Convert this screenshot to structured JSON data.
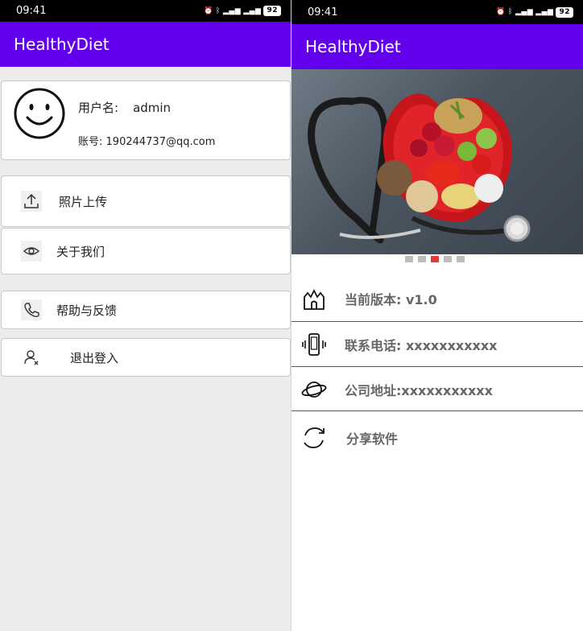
{
  "status_bar": {
    "time": "09:41",
    "battery": "92"
  },
  "app": {
    "title": "HealthyDiet"
  },
  "profile": {
    "username_label": "用户名:",
    "username": "admin",
    "account_label": "账号:",
    "account": "190244737@qq.com",
    "avatar_icon": "smiley-face-icon"
  },
  "menu": {
    "items": [
      {
        "label": "照片上传",
        "icon": "upload-icon"
      },
      {
        "label": "关于我们",
        "icon": "eye-icon"
      },
      {
        "label": "帮助与反馈",
        "icon": "phone-icon"
      },
      {
        "label": "退出登入",
        "icon": "user-logout-icon"
      }
    ]
  },
  "carousel": {
    "slides": 5,
    "active_index": 2,
    "active_color": "#e53935"
  },
  "info": {
    "items": [
      {
        "label": "当前版本: v1.0",
        "icon": "castle-icon"
      },
      {
        "label": "联系电话: xxxxxxxxxxx",
        "icon": "mobile-vibrate-icon"
      },
      {
        "label": "公司地址:xxxxxxxxxxx",
        "icon": "planet-icon"
      },
      {
        "label": "分享软件",
        "icon": "refresh-icon"
      }
    ]
  },
  "colors": {
    "app_bar": "#6200ee",
    "status_bar": "#000000",
    "background": "#ececec"
  }
}
